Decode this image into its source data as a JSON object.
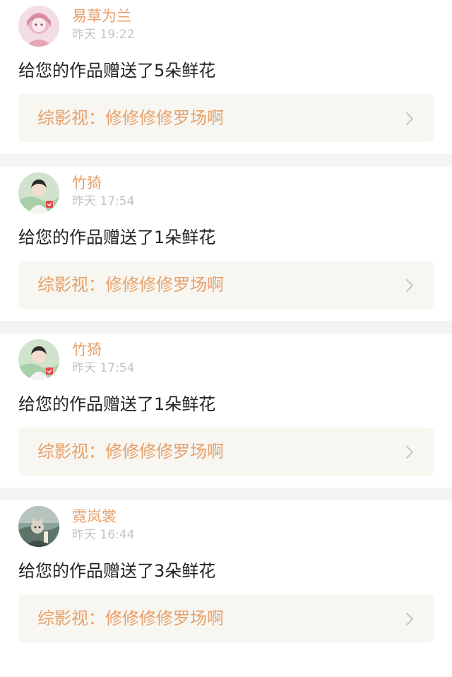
{
  "notifications": [
    {
      "username": "易草为兰",
      "time": "昨天 19:22",
      "message": "给您的作品赠送了5朵鲜花",
      "work_title": "综影视：修修修修罗场啊",
      "avatar": "avatar-anime-girl-pink"
    },
    {
      "username": "竹猗",
      "time": "昨天 17:54",
      "message": "给您的作品赠送了1朵鲜花",
      "work_title": "综影视：修修修修罗场啊",
      "avatar": "avatar-man-green-background"
    },
    {
      "username": "竹猗",
      "time": "昨天 17:54",
      "message": "给您的作品赠送了1朵鲜花",
      "work_title": "综影视：修修修修罗场啊",
      "avatar": "avatar-man-green-background"
    },
    {
      "username": "霓岚裳",
      "time": "昨天 16:44",
      "message": "给您的作品赠送了3朵鲜花",
      "work_title": "综影视：修修修修罗场啊",
      "avatar": "avatar-ink-painting-cat"
    }
  ],
  "icons": {
    "chevron": "chevron-right-icon"
  },
  "colors": {
    "accent": "#e8a06a",
    "timestamp": "#c3c3c3",
    "message_text": "#222222",
    "link_background": "#f7f6f0",
    "separator": "#f4f4f4",
    "chevron": "#c8c8c8"
  }
}
